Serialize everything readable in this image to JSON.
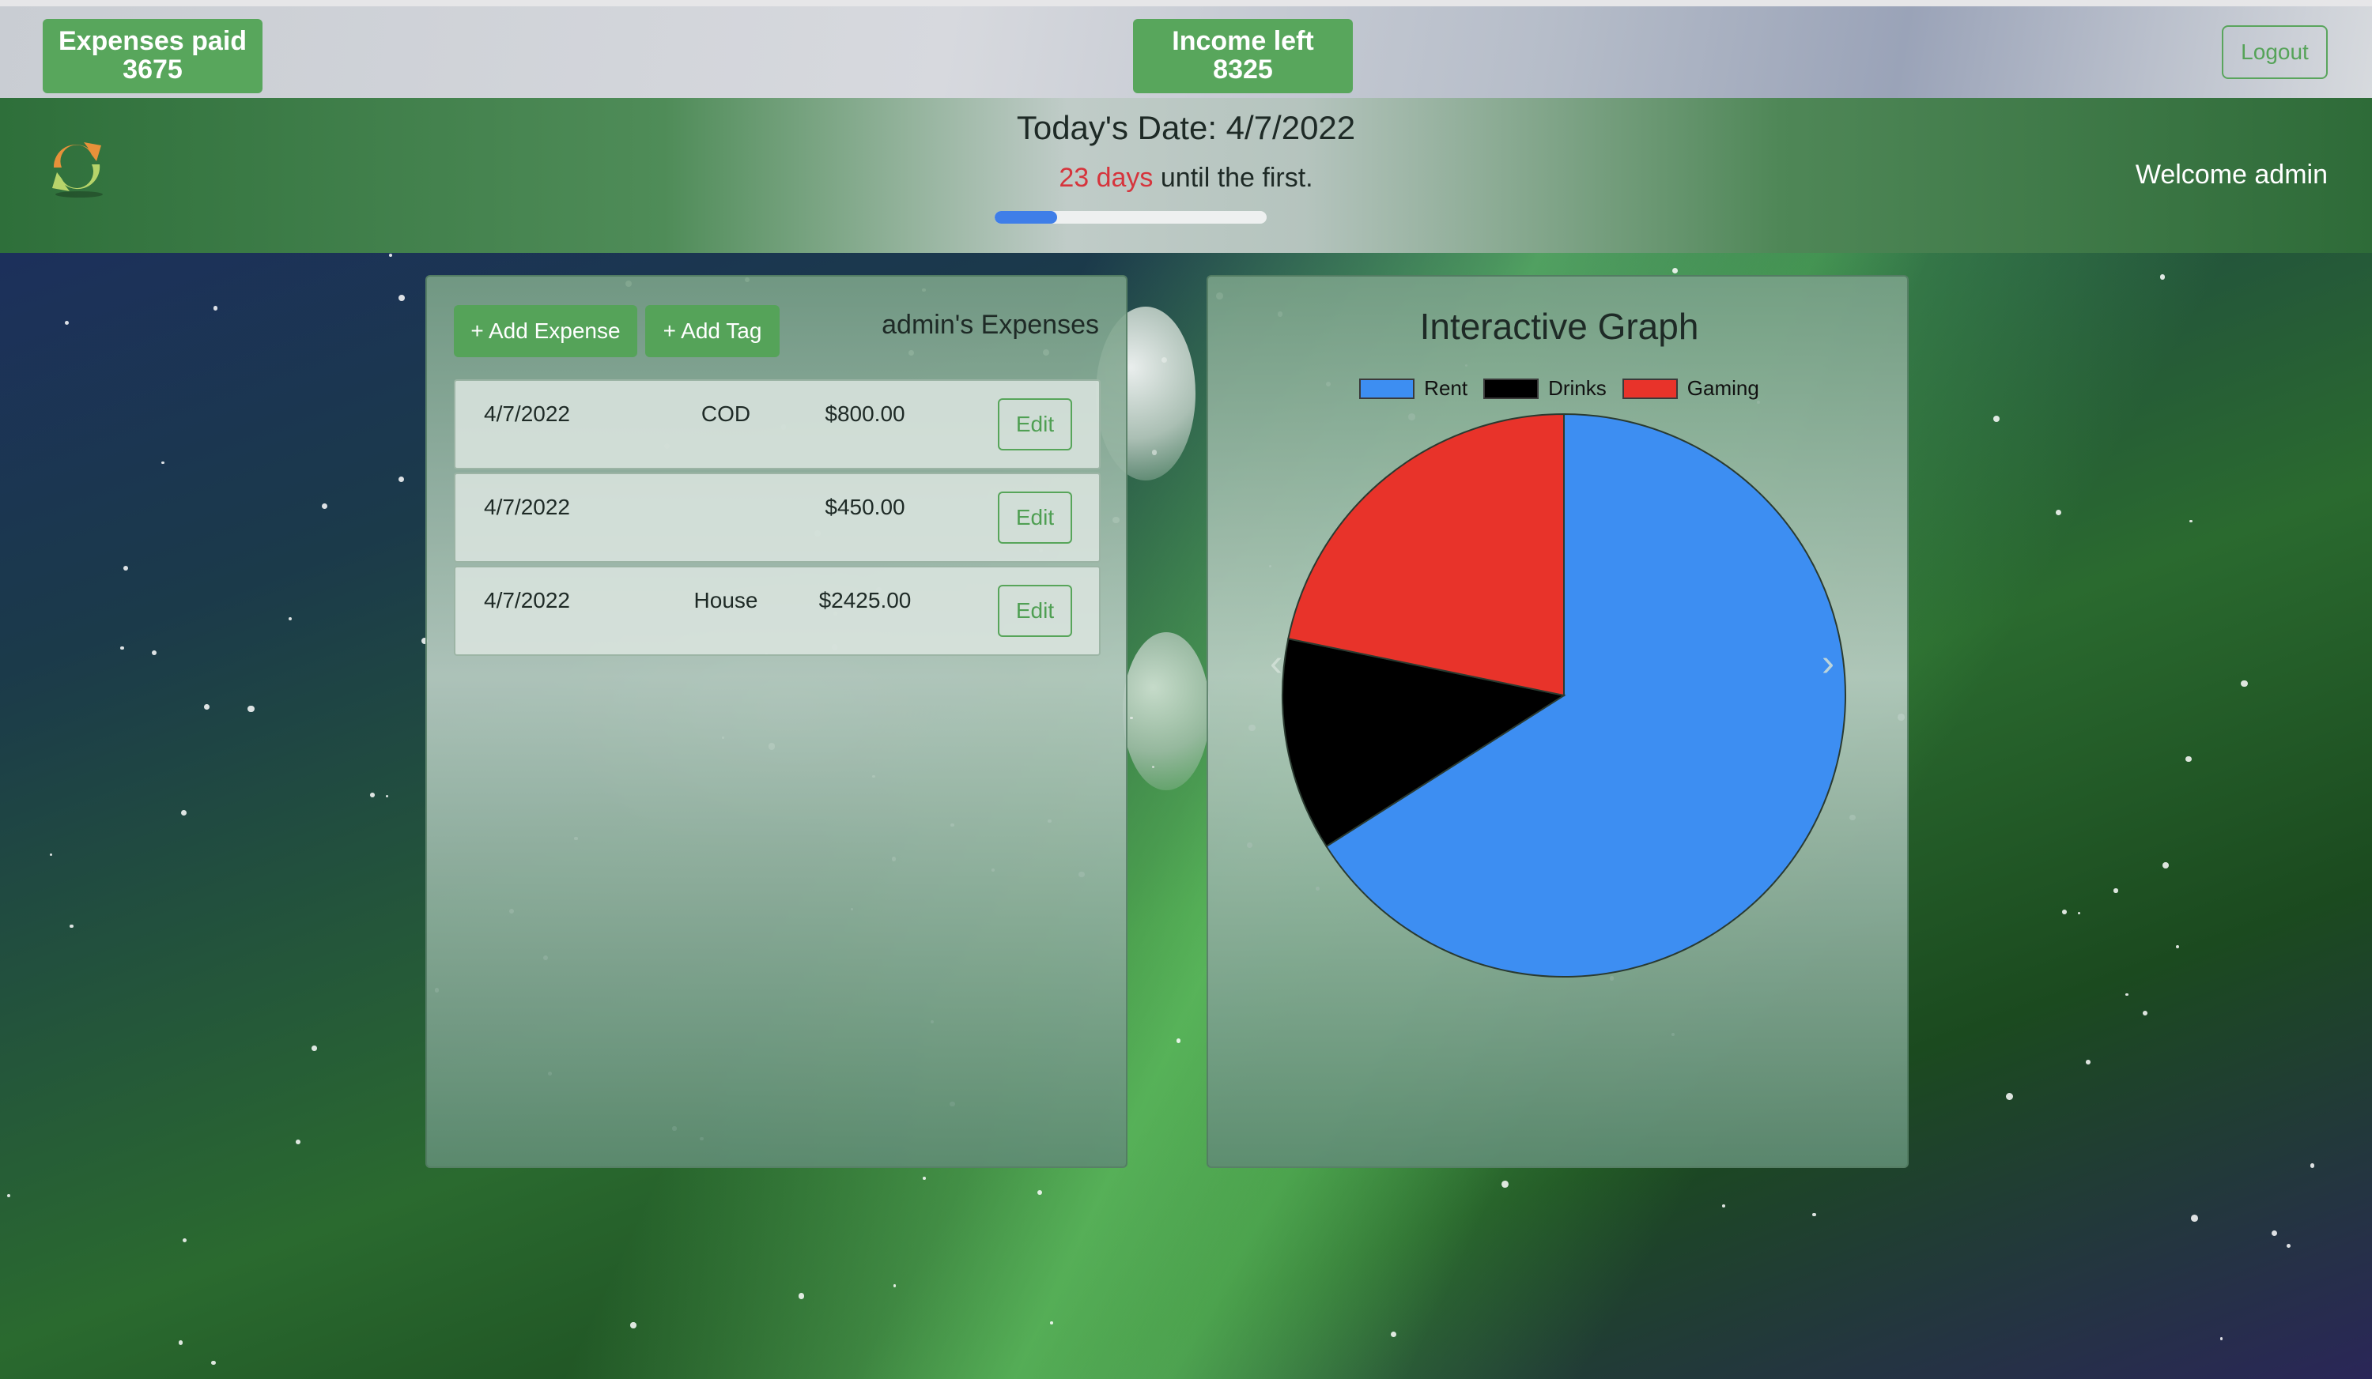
{
  "topbar": {
    "expenses_label": "Expenses paid",
    "expenses_value": "3675",
    "income_label": "Income left",
    "income_value": "8325",
    "logout_label": "Logout"
  },
  "header": {
    "date_title": "Today's Date: 4/7/2022",
    "days_text": "23 days",
    "until_text": " until the first.",
    "progress_fraction": 0.23,
    "welcome": "Welcome admin",
    "logo_icon": "recycle-arrows-icon"
  },
  "expenses_panel": {
    "add_expense_label": "+ Add Expense",
    "add_tag_label": "+ Add Tag",
    "title": "admin's Expenses",
    "edit_label": "Edit",
    "rows": [
      {
        "date": "4/7/2022",
        "tag": "COD",
        "amount": "$800.00"
      },
      {
        "date": "4/7/2022",
        "tag": "",
        "amount": "$450.00"
      },
      {
        "date": "4/7/2022",
        "tag": "House",
        "amount": "$2425.00"
      }
    ]
  },
  "graph_panel": {
    "title": "Interactive Graph",
    "prev_icon": "chevron-left-icon",
    "next_icon": "chevron-right-icon"
  },
  "chart_data": {
    "type": "pie",
    "title": "Interactive Graph",
    "legend_position": "top",
    "categories": [
      "Rent",
      "Drinks",
      "Gaming"
    ],
    "values": [
      2425,
      450,
      800
    ],
    "colors": [
      "#3d8ef2",
      "#000000",
      "#e8332a"
    ]
  },
  "colors": {
    "accent_green": "#58a65c",
    "countdown_red": "#d6343c",
    "progress_blue": "#3f7ee8"
  }
}
